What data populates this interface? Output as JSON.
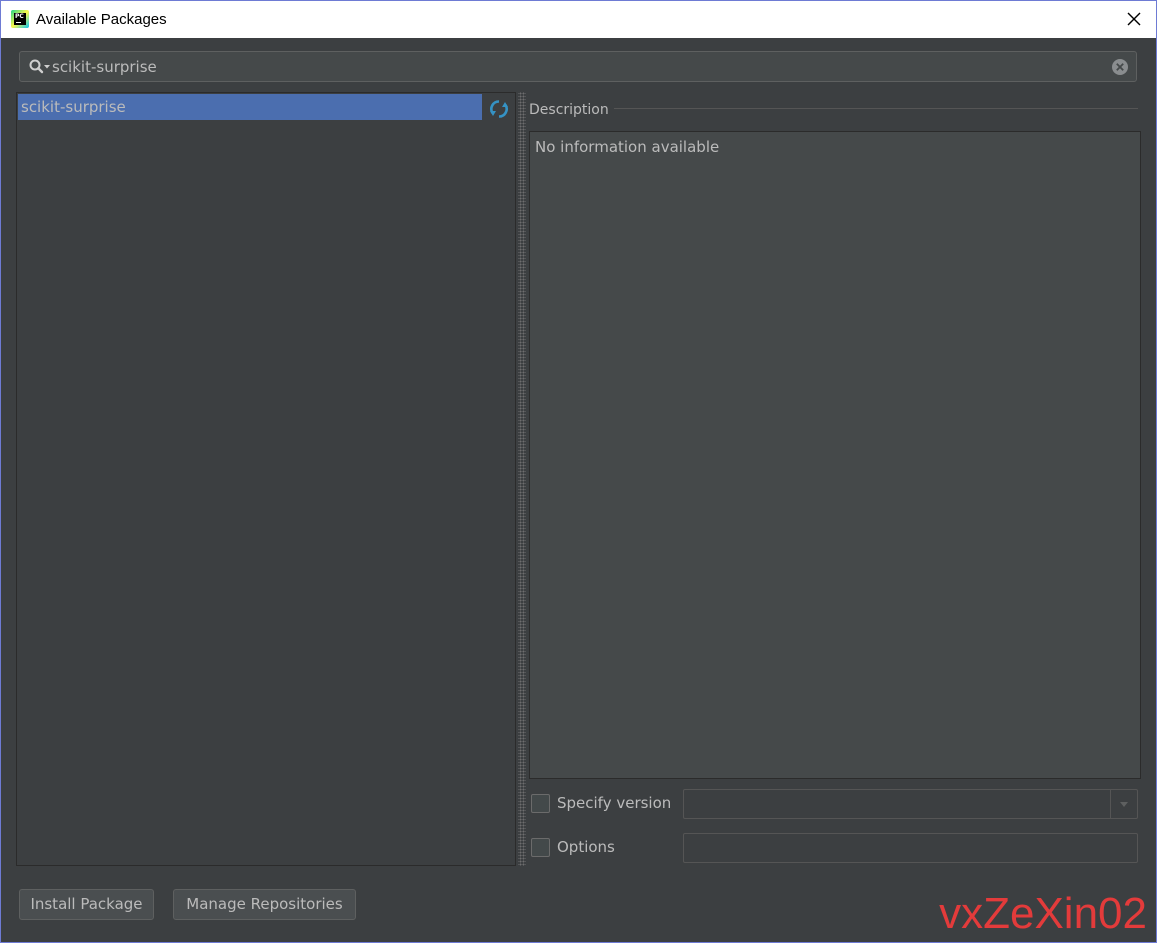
{
  "window": {
    "title": "Available Packages",
    "icon": "pycharm-icon",
    "icon_text": "PC"
  },
  "search": {
    "value": "scikit-surprise",
    "placeholder": ""
  },
  "package_list": {
    "items": [
      {
        "label": "scikit-surprise",
        "selected": true
      }
    ]
  },
  "description": {
    "label": "Description",
    "text": "No information available"
  },
  "specify_version": {
    "label": "Specify version",
    "checked": false,
    "value": ""
  },
  "options": {
    "label": "Options",
    "checked": false,
    "value": ""
  },
  "buttons": {
    "install": "Install Package",
    "manage": "Manage Repositories"
  },
  "watermark": {
    "text": "vxZeXin02"
  },
  "colors": {
    "background": "#3c3f41",
    "selection": "#4b6eaf",
    "text": "#bbbbbb",
    "watermark": "#e33b3b",
    "reload_icon": "#3592c4"
  }
}
